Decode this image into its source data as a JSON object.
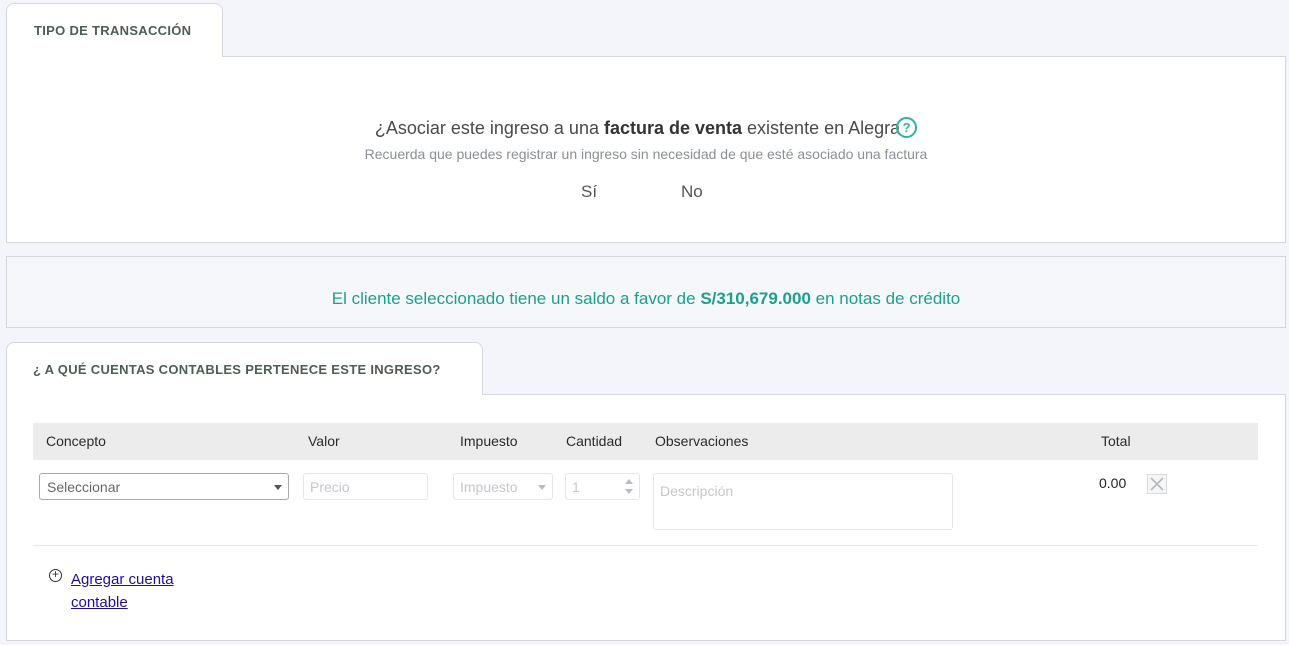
{
  "transaction": {
    "tab_label": "TIPO DE TRANSACCIÓN",
    "question_prefix": "¿Asociar este ingreso a una ",
    "question_bold": "factura de venta",
    "question_suffix": " existente en Alegra",
    "help_icon": "?",
    "subtitle": "Recuerda que puedes registrar un ingreso sin necesidad de que esté asociado una factura",
    "option_yes": "Sí",
    "option_no": "No"
  },
  "credit_notice": {
    "prefix": "El cliente seleccionado tiene un saldo a favor de ",
    "amount": "S/310,679.000",
    "suffix": " en notas de crédito"
  },
  "accounts": {
    "tab_label": "¿ A QUÉ CUENTAS CONTABLES PERTENECE ESTE INGRESO?",
    "columns": {
      "concepto": "Concepto",
      "valor": "Valor",
      "impuesto": "Impuesto",
      "cantidad": "Cantidad",
      "observaciones": "Observaciones",
      "total": "Total"
    },
    "row": {
      "concept_value": "Seleccionar",
      "price_placeholder": "Precio",
      "tax_value": "Impuesto",
      "quantity_value": "1",
      "description_placeholder": "Descripción",
      "total": "0.00"
    },
    "add_link_label": "Agregar cuenta contable",
    "colors": {
      "accent": "#1aa18e",
      "link": "#1a0dab"
    }
  }
}
